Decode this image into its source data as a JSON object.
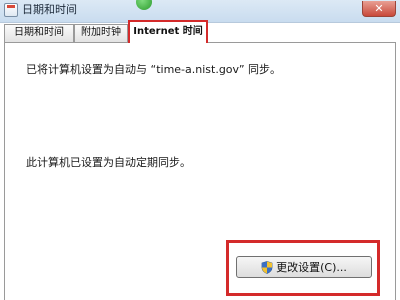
{
  "window": {
    "title": "日期和时间",
    "close_label": "✕"
  },
  "tabs": [
    {
      "label": "日期和时间"
    },
    {
      "label": "附加时钟"
    },
    {
      "label": "Internet 时间",
      "active": true
    }
  ],
  "main": {
    "sync_message": "已将计算机设置为自动与 “time-a.nist.gov” 同步。",
    "auto_sync_message": "此计算机已设置为自动定期同步。",
    "change_settings_label": "更改设置(C)..."
  },
  "colors": {
    "highlight": "#d42a2a",
    "titlebar": "#c9dcef"
  },
  "icons": {
    "window": "calendar-icon",
    "button": "uac-shield-icon"
  }
}
